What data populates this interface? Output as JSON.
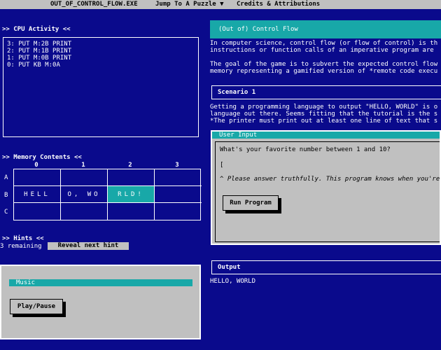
{
  "menu": {
    "app": "OUT_OF_CONTROL_FLOW.EXE",
    "jump": "Jump To A Puzzle ▼",
    "credits": "Credits & Attributions"
  },
  "cpu": {
    "heading": ">> CPU Activity <<",
    "lines": [
      "3: PUT M:2B PRINT",
      "2: PUT M:1B PRINT",
      "1: PUT M:0B PRINT",
      "0: PUT KB M:0A"
    ]
  },
  "memory": {
    "heading": ">> Memory Contents <<",
    "columns": [
      "0",
      "1",
      "2",
      "3"
    ],
    "rows": [
      {
        "label": "A",
        "cells": [
          "",
          "",
          "",
          ""
        ]
      },
      {
        "label": "B",
        "cells": [
          "HELL",
          "O, WO",
          "RLD!",
          ""
        ]
      },
      {
        "label": "C",
        "cells": [
          "",
          "",
          "",
          ""
        ]
      }
    ],
    "highlight_cell": "B2"
  },
  "hints": {
    "heading": ">> Hints <<",
    "remaining": "3 remaining",
    "reveal_label": "Reveal next hint"
  },
  "music": {
    "title": "Music",
    "play_pause_label": "Play/Pause"
  },
  "intro": {
    "title": "(Out of) Control Flow",
    "para1": [
      "In computer science, control flow (or flow of control) is th",
      "instructions or function calls of an imperative program are"
    ],
    "para2": [
      "The goal of the game is to subvert the expected control flow",
      "memory representing a gamified version of *remote code execu"
    ]
  },
  "scenario": {
    "heading": "Scenario 1",
    "lines": [
      "Getting a programming language to output \"HELLO, WORLD\" is o",
      "language out there. Seems fitting that the tutorial is the s",
      "*The printer must print out at least one line of text that s"
    ]
  },
  "user_input": {
    "title": "User Input",
    "question": "What's your favorite number between 1 and 10?",
    "value": "",
    "note": "^ Please answer truthfully. This program knows when you're",
    "run_label": "Run Program"
  },
  "output": {
    "heading": "Output",
    "text": "HELLO, WORLD"
  },
  "colors": {
    "background": "#0a0a8c",
    "accent": "#18a8a8",
    "panel": "#c0c0c0"
  }
}
